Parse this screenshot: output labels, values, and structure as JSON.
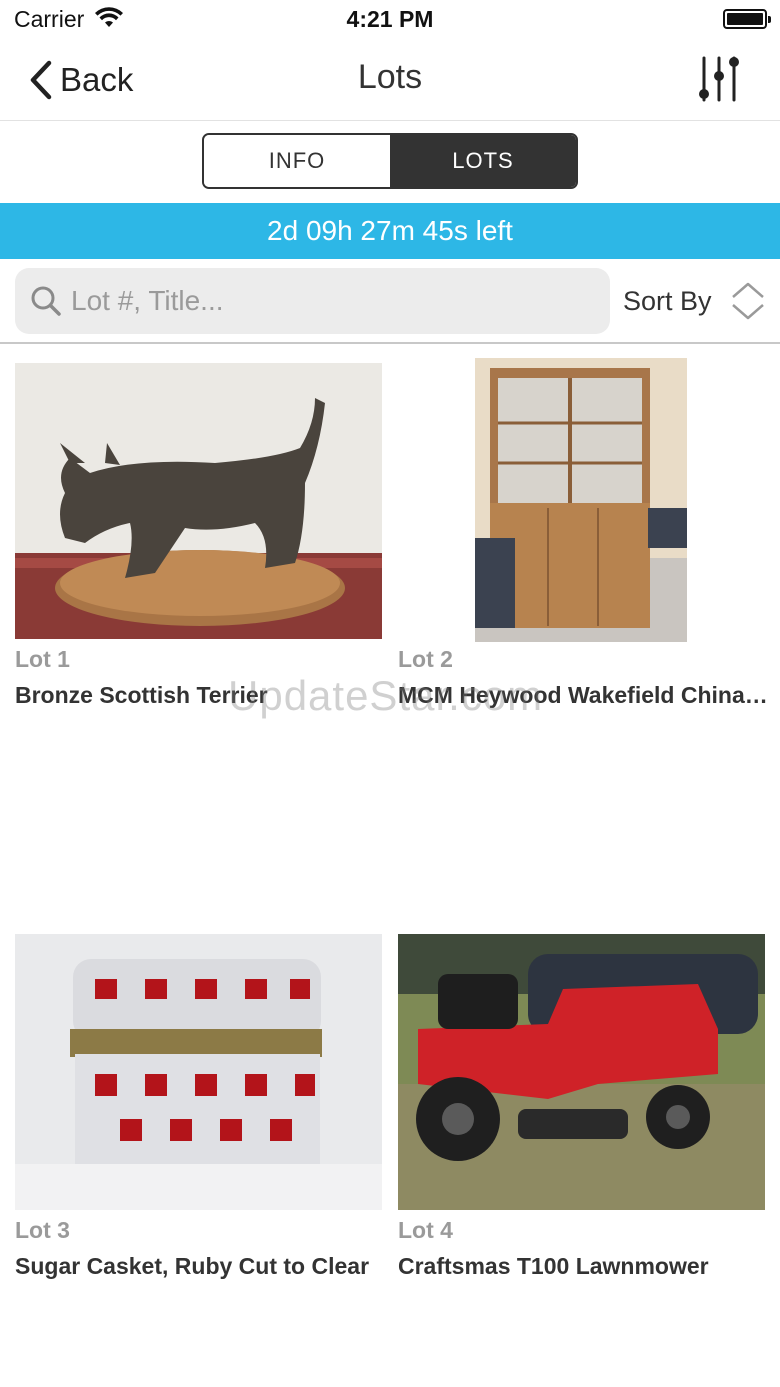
{
  "status_bar": {
    "carrier": "Carrier",
    "time": "4:21 PM"
  },
  "nav": {
    "back_label": "Back",
    "title": "Lots"
  },
  "segments": [
    {
      "label": "INFO",
      "active": false
    },
    {
      "label": "LOTS",
      "active": true
    }
  ],
  "countdown": {
    "text": "2d 09h 27m 45s left",
    "color": "#2db7e6"
  },
  "search": {
    "placeholder": "Lot #, Title...",
    "value": ""
  },
  "sort": {
    "label": "Sort By"
  },
  "lots": [
    {
      "number": "Lot 1",
      "title": "Bronze Scottish Terrier"
    },
    {
      "number": "Lot 2",
      "title": "MCM Heywood Wakefield China Cabinet"
    },
    {
      "number": "Lot 3",
      "title": "Sugar Casket, Ruby Cut to Clear"
    },
    {
      "number": "Lot 4",
      "title": "Craftsmas T100 Lawnmower"
    }
  ],
  "watermark": "UpdateStar.com"
}
